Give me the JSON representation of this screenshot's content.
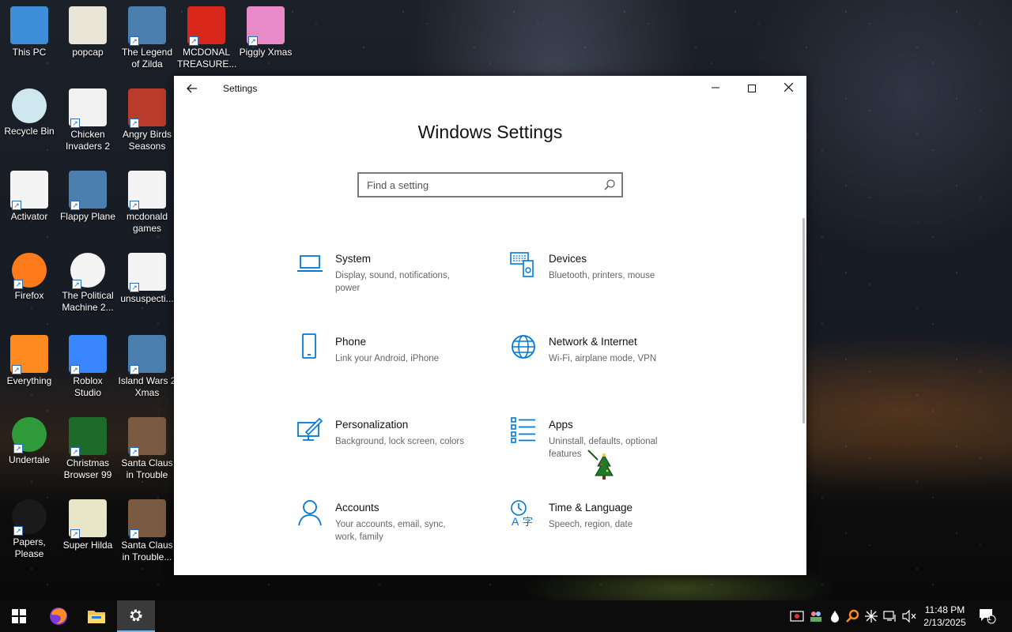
{
  "desktop": {
    "icons": [
      {
        "label": "This PC",
        "icon": "computer-icon"
      },
      {
        "label": "popcap",
        "icon": "folder-app-icon"
      },
      {
        "label": "The Legend of Zilda",
        "icon": "game-icon"
      },
      {
        "label": "MCDONAL TREASURE...",
        "icon": "mcdonalds-icon"
      },
      {
        "label": "Piggly Xmas",
        "icon": "pig-game-icon"
      },
      {
        "label": "Recycle Bin",
        "icon": "recycle-bin-icon"
      },
      {
        "label": "Chicken Invaders 2",
        "icon": "chicken-game-icon"
      },
      {
        "label": "Angry Birds Seasons",
        "icon": "angry-birds-icon"
      },
      {
        "label": "Activator",
        "icon": "file-icon"
      },
      {
        "label": "Flappy Plane",
        "icon": "game-icon"
      },
      {
        "label": "mcdonald games",
        "icon": "file-icon"
      },
      {
        "label": "Firefox",
        "icon": "firefox-icon"
      },
      {
        "label": "The Political Machine 2...",
        "icon": "political-game-icon"
      },
      {
        "label": "unsuspecti...",
        "icon": "file-icon"
      },
      {
        "label": "Everything",
        "icon": "search-app-icon"
      },
      {
        "label": "Roblox Studio",
        "icon": "roblox-icon"
      },
      {
        "label": "Island Wars 2 Xmas",
        "icon": "game-icon"
      },
      {
        "label": "Undertale",
        "icon": "undertale-icon"
      },
      {
        "label": "Christmas Browser 99",
        "icon": "christmas-tree-icon"
      },
      {
        "label": "Santa Claus in Trouble",
        "icon": "santa-icon"
      },
      {
        "label": "Papers, Please",
        "icon": "papers-please-icon"
      },
      {
        "label": "Super Hilda",
        "icon": "pixel-game-icon"
      },
      {
        "label": "Santa Claus in Trouble...",
        "icon": "santa-icon"
      }
    ]
  },
  "window": {
    "title": "Settings",
    "heading": "Windows Settings",
    "search_placeholder": "Find a setting",
    "categories": [
      {
        "name": "System",
        "desc": "Display, sound, notifications, power",
        "icon": "laptop-icon"
      },
      {
        "name": "Devices",
        "desc": "Bluetooth, printers, mouse",
        "icon": "keyboard-devices-icon"
      },
      {
        "name": "Phone",
        "desc": "Link your Android, iPhone",
        "icon": "phone-icon"
      },
      {
        "name": "Network & Internet",
        "desc": "Wi-Fi, airplane mode, VPN",
        "icon": "globe-icon"
      },
      {
        "name": "Personalization",
        "desc": "Background, lock screen, colors",
        "icon": "brush-monitor-icon"
      },
      {
        "name": "Apps",
        "desc": "Uninstall, defaults, optional features",
        "icon": "apps-list-icon"
      },
      {
        "name": "Accounts",
        "desc": "Your accounts, email, sync, work, family",
        "icon": "person-icon"
      },
      {
        "name": "Time & Language",
        "desc": "Speech, region, date",
        "icon": "time-language-icon"
      }
    ]
  },
  "taskbar": {
    "time": "11:48 PM",
    "date": "2/13/2025",
    "notification_count": "1",
    "accent": "#0078d7"
  }
}
